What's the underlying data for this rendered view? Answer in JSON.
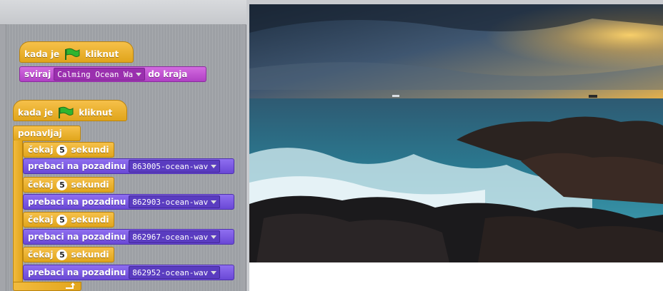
{
  "scripts": {
    "script1": {
      "hat": {
        "before": "kada je",
        "after": "kliknut"
      },
      "sound": {
        "label": "sviraj",
        "value": "Calming Ocean Wa",
        "after": "do kraja"
      }
    },
    "script2": {
      "hat": {
        "before": "kada je",
        "after": "kliknut"
      },
      "forever": "ponavljaj",
      "wait_label": "čekaj",
      "wait_value": "5",
      "wait_unit": "sekundi",
      "switch_label": "prebaci na pozadinu",
      "backdrops": [
        "863005-ocean-wav",
        "862903-ocean-wav",
        "862967-ocean-wav",
        "862952-ocean-wav"
      ]
    }
  },
  "icons": {
    "flag": "green-flag-icon",
    "loop": "loop-arrow-icon",
    "dropdown": "dropdown-arrow-icon"
  },
  "colors": {
    "control": "#e6ad24",
    "sound": "#c04fd2",
    "looks": "#7a5ae6",
    "flag": "#2fb52f"
  }
}
